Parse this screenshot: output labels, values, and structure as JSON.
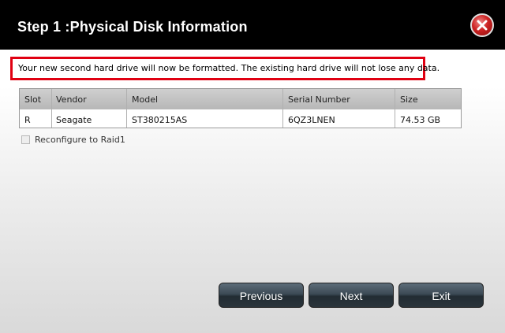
{
  "dialog": {
    "title": "Step 1 :Physical Disk Information",
    "close_icon": "close-icon",
    "accent_color": "#e00012",
    "notice": "Your new second hard drive will now be formatted. The existing hard drive will not lose any data."
  },
  "table": {
    "columns": [
      "Slot",
      "Vendor",
      "Model",
      "Serial Number",
      "Size"
    ],
    "rows": [
      [
        "R",
        "Seagate",
        "ST380215AS",
        "6QZ3LNEN",
        "74.53 GB"
      ]
    ]
  },
  "options": {
    "raid_label": "Reconfigure to Raid1",
    "raid_checked": false
  },
  "buttons": {
    "previous": "Previous",
    "next": "Next",
    "exit": "Exit"
  }
}
